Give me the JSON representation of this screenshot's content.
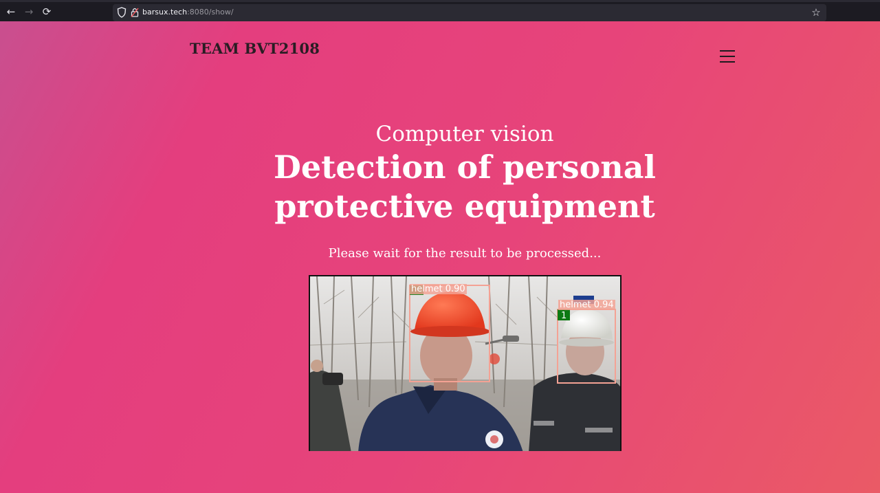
{
  "browser": {
    "url_host": "barsux.tech",
    "url_rest": ":8080/show/"
  },
  "header": {
    "brand": "TEAM BVT2108"
  },
  "hero": {
    "kicker": "Computer vision",
    "title_line1": "Detection of personal",
    "title_line2": "protective equipment",
    "status": "Please wait for the result to be processed..."
  },
  "result": {
    "detections": [
      {
        "label": "helmet",
        "score": "0.90",
        "text": "helmet  0.90"
      },
      {
        "label": "helmet",
        "score": "0.94",
        "text": "helmet  0.94"
      }
    ],
    "box_color": "#f4a294",
    "track_badge": "1"
  },
  "colors": {
    "gradient_start": "#c94f8f",
    "gradient_mid": "#e43e7e",
    "gradient_end": "#ea5a66",
    "brand_text": "#2a1d24"
  }
}
